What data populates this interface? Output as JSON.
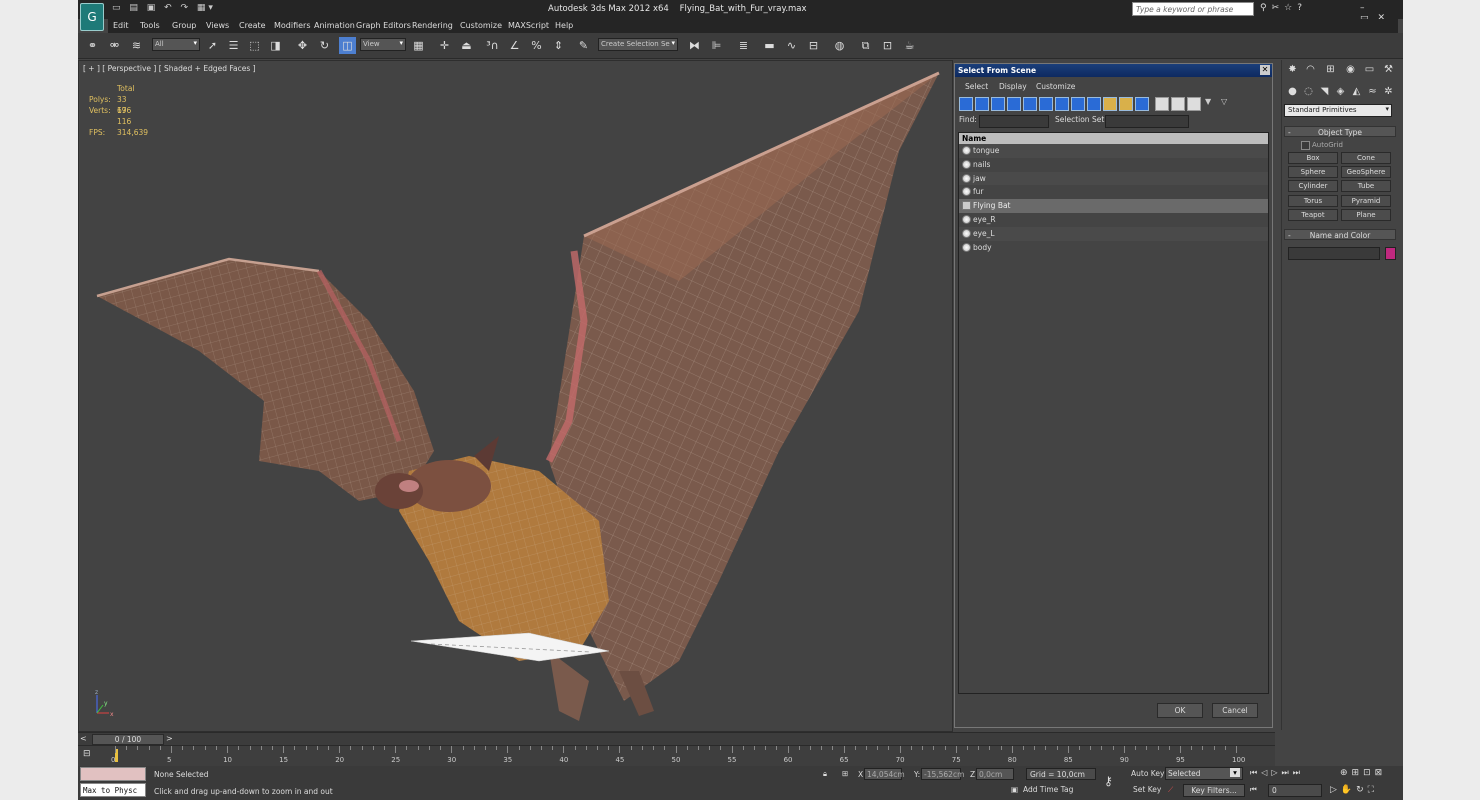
{
  "title": {
    "app": "Autodesk 3ds Max  2012 x64",
    "file": "Flying_Bat_with_Fur_vray.max",
    "search_placeholder": "Type a keyword or phrase"
  },
  "menu": [
    "Edit",
    "Tools",
    "Group",
    "Views",
    "Create",
    "Modifiers",
    "Animation",
    "Graph Editors",
    "Rendering",
    "Customize",
    "MAXScript",
    "Help"
  ],
  "toolbar": {
    "filter_value": "All",
    "refcoord_value": "View",
    "selection_set_placeholder": "Create Selection Se"
  },
  "viewport": {
    "label": "[ + ] [ Perspective ] [ Shaded + Edged Faces ]",
    "stats": {
      "header": "Total",
      "polys_label": "Polys:",
      "polys": "33 696",
      "verts_label": "Verts:",
      "verts": "17 116",
      "fps_label": "FPS:",
      "fps": "314,639"
    },
    "axis": {
      "x": "x",
      "y": "y",
      "z": "z"
    }
  },
  "dialog": {
    "title": "Select From Scene",
    "menu": [
      "Select",
      "Display",
      "Customize"
    ],
    "find_label": "Find:",
    "selset_label": "Selection Set:",
    "column": "Name",
    "items": [
      {
        "name": "tongue",
        "selected": false,
        "icon": "geometry-icon"
      },
      {
        "name": "nails",
        "selected": false,
        "icon": "geometry-icon"
      },
      {
        "name": "jaw",
        "selected": false,
        "icon": "geometry-icon"
      },
      {
        "name": "fur",
        "selected": false,
        "icon": "geometry-icon"
      },
      {
        "name": "Flying Bat",
        "selected": true,
        "icon": "group-icon"
      },
      {
        "name": "eye_R",
        "selected": false,
        "icon": "geometry-icon"
      },
      {
        "name": "eye_L",
        "selected": false,
        "icon": "geometry-icon"
      },
      {
        "name": "body",
        "selected": false,
        "icon": "geometry-icon"
      }
    ],
    "ok": "OK",
    "cancel": "Cancel"
  },
  "command_panel": {
    "category": "Standard Primitives",
    "object_type_title": "Object Type",
    "autogrid": "AutoGrid",
    "buttons": [
      "Box",
      "Cone",
      "Sphere",
      "GeoSphere",
      "Cylinder",
      "Tube",
      "Torus",
      "Pyramid",
      "Teapot",
      "Plane"
    ],
    "name_color_title": "Name and Color",
    "color": "#c0297f"
  },
  "timeline": {
    "slider": "0 / 100",
    "ticks": [
      "0",
      "5",
      "10",
      "15",
      "20",
      "25",
      "30",
      "35",
      "40",
      "45",
      "50",
      "55",
      "60",
      "65",
      "70",
      "75",
      "80",
      "85",
      "90",
      "95",
      "100"
    ]
  },
  "status": {
    "maxscript": "Max to Physc",
    "selection": "None Selected",
    "prompt": "Click and drag up-and-down to zoom in and out",
    "x_label": "X:",
    "x_value": "14,054cm",
    "y_label": "Y:",
    "y_value": "-15,562cm",
    "z_label": "Z:",
    "z_value": "0,0cm",
    "grid": "Grid = 10,0cm",
    "add_time_tag": "Add Time Tag",
    "auto_key": "Auto Key",
    "set_key": "Set Key",
    "key_mode": "Selected",
    "key_filters": "Key Filters...",
    "frame": "0"
  }
}
